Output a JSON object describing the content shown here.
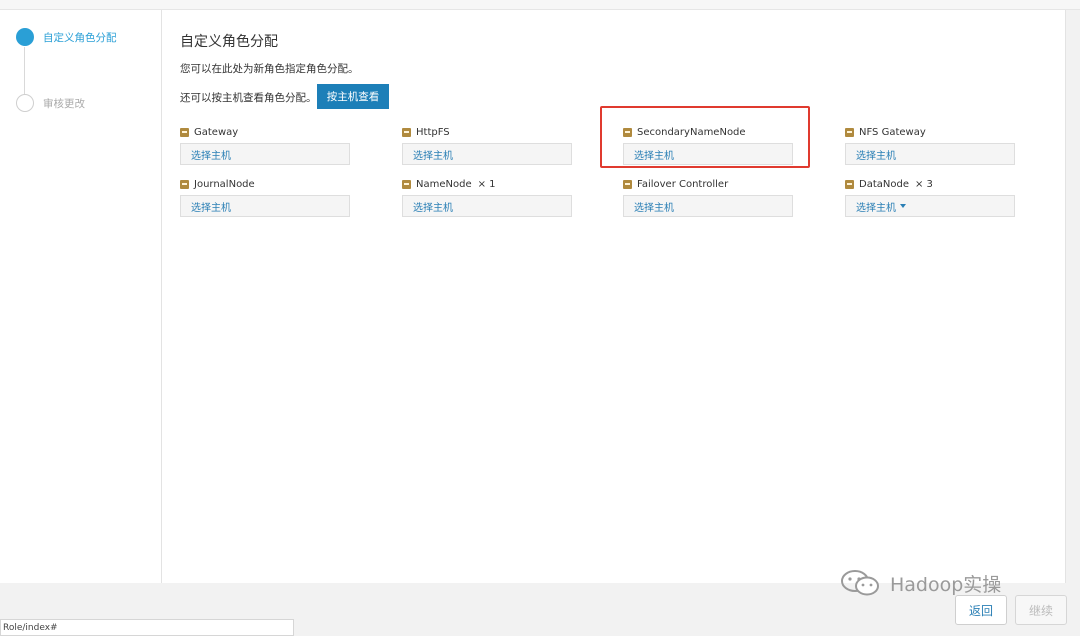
{
  "steps": [
    {
      "label": "自定义角色分配",
      "active": true
    },
    {
      "label": "审核更改",
      "active": false
    }
  ],
  "main": {
    "title": "自定义角色分配",
    "desc1": "您可以在此处为新角色指定角色分配。",
    "desc2": "还可以按主机查看角色分配。",
    "view_by_host_button": "按主机查看"
  },
  "roles": [
    {
      "name": "Gateway",
      "count": "",
      "host": "选择主机",
      "dropdown": false
    },
    {
      "name": "HttpFS",
      "count": "",
      "host": "选择主机",
      "dropdown": false
    },
    {
      "name": "SecondaryNameNode",
      "count": "",
      "host": "选择主机",
      "dropdown": false
    },
    {
      "name": "NFS Gateway",
      "count": "",
      "host": "选择主机",
      "dropdown": false
    },
    {
      "name": "JournalNode",
      "count": "",
      "host": "选择主机",
      "dropdown": false
    },
    {
      "name": "NameNode",
      "count": "× 1",
      "host": "选择主机",
      "dropdown": false
    },
    {
      "name": "Failover Controller",
      "count": "",
      "host": "选择主机",
      "dropdown": false
    },
    {
      "name": "DataNode",
      "count": "× 3",
      "host": "选择主机",
      "dropdown": true
    }
  ],
  "footer": {
    "back_button": "返回",
    "continue_button": "继续",
    "status_url": "Role/index#",
    "watermark": "Hadoop实操"
  },
  "icons": {
    "role_icon": "role-type-icon",
    "watermark_icon": "wechat-icon"
  },
  "colors": {
    "accent": "#2a9fd6",
    "button_primary": "#1d7fb8",
    "highlight": "#e03a2f",
    "link": "#2a7fb5"
  }
}
